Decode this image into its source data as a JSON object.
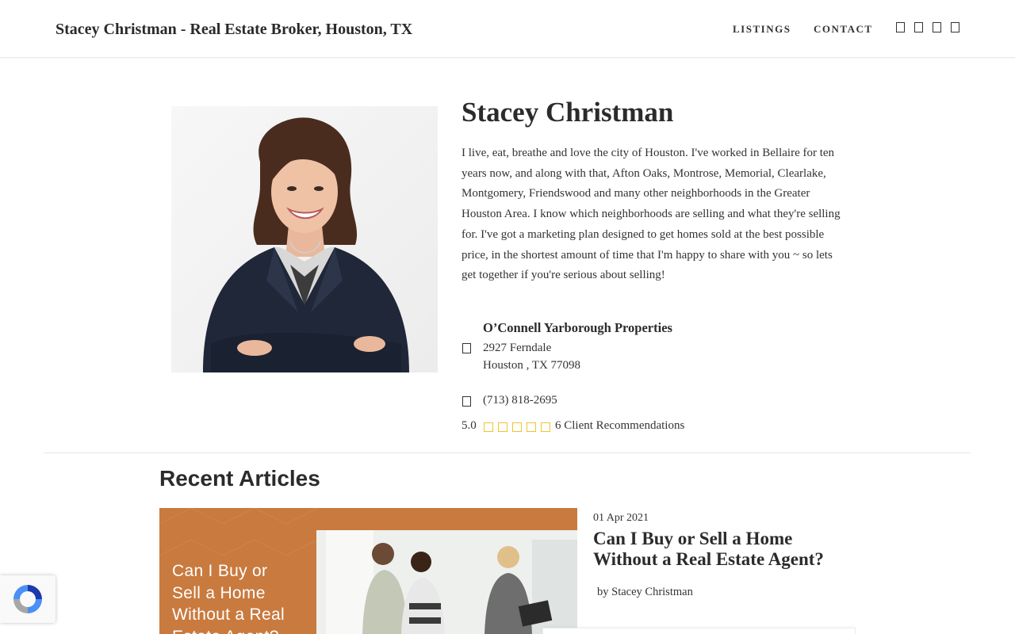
{
  "header": {
    "brand": "Stacey Christman - Real Estate Broker, Houston, TX",
    "nav": {
      "listings": "LISTINGS",
      "contact": "CONTACT"
    },
    "social_icons": [
      "facebook-icon",
      "twitter-icon",
      "linkedin-icon",
      "instagram-icon"
    ]
  },
  "profile": {
    "name": "Stacey Christman",
    "bio": "I live, eat, breathe and love the city of Houston. I've worked in Bellaire for ten years now, and along with that, Afton Oaks, Montrose, Memorial, Clearlake, Montgomery, Friendswood and many other neighborhoods in the Greater Houston Area. I know which neighborhoods are selling and what they're selling for. I've got a marketing plan designed to get homes sold at the best possible price, in the shortest amount of time that I'm happy to share with you ~ so lets get together if you're serious about selling!",
    "company": "O’Connell Yarborough Properties",
    "address_line1": "2927 Ferndale",
    "address_line2": "Houston , TX 77098",
    "phone": "(713) 818-2695",
    "rating": "5.0",
    "stars_filled": 5,
    "stars_total": 5,
    "recommendations": "6 Client Recommendations"
  },
  "articles": {
    "heading": "Recent Articles",
    "items": [
      {
        "image_text": [
          "Can I Buy or",
          "Sell a Home",
          "Without a Real",
          "Estate Agent?"
        ],
        "date": "01 Apr 2021",
        "title": "Can I Buy or Sell a Home Without a Real Estate Agent?",
        "byline": "by Stacey Christman"
      }
    ]
  },
  "colors": {
    "accent_star": "#f2c230",
    "article_image_bg": "#c97a3e",
    "text": "#333333"
  }
}
